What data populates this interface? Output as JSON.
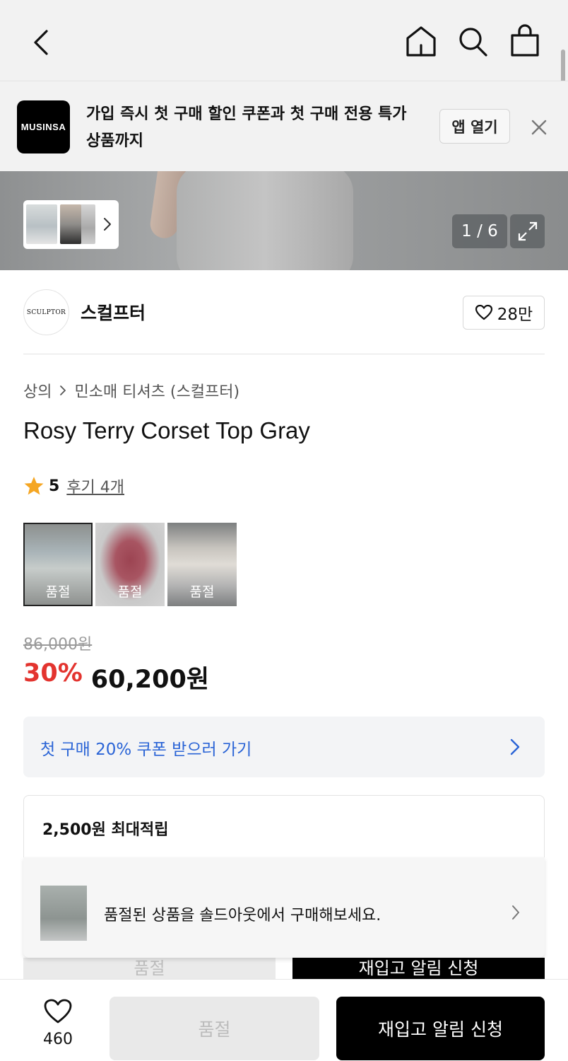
{
  "app_banner": {
    "logo_text": "MUSINSA",
    "message": "가입 즉시 첫 구매 할인 쿠폰과 첫 구매 전용 특가 상품까지",
    "open_label": "앱 열기"
  },
  "gallery": {
    "counter": "1 / 6"
  },
  "brand": {
    "logo_text": "SCULPTOR",
    "name": "스컬프터",
    "likes": "28만"
  },
  "breadcrumb": {
    "category": "상의",
    "subcategory": "민소매 티셔츠 (스컬프터)"
  },
  "product": {
    "title": "Rosy Terry Corset Top Gray",
    "rating": "5",
    "reviews_label": "후기 4개",
    "options": [
      {
        "label": "품절"
      },
      {
        "label": "품절"
      },
      {
        "label": "품절"
      }
    ],
    "original_price": "86,000원",
    "discount": "30%",
    "sale_price": "60,200원"
  },
  "coupon": {
    "label": "첫 구매 20% 쿠폰 받으러 가기"
  },
  "points": {
    "label": "2,500원 최대적립"
  },
  "soldout_notice": {
    "message": "품절된 상품을 솔드아웃에서 구매해보세요."
  },
  "behind_buttons": {
    "soldout": "품절",
    "restock": "재입고 알림 신청"
  },
  "bottom_bar": {
    "wish_count": "460",
    "soldout_label": "품절",
    "restock_label": "재입고 알림 신청"
  },
  "colors": {
    "discount": "#e3342f",
    "coupon_link": "#2a64d6",
    "star": "#f5a623"
  }
}
